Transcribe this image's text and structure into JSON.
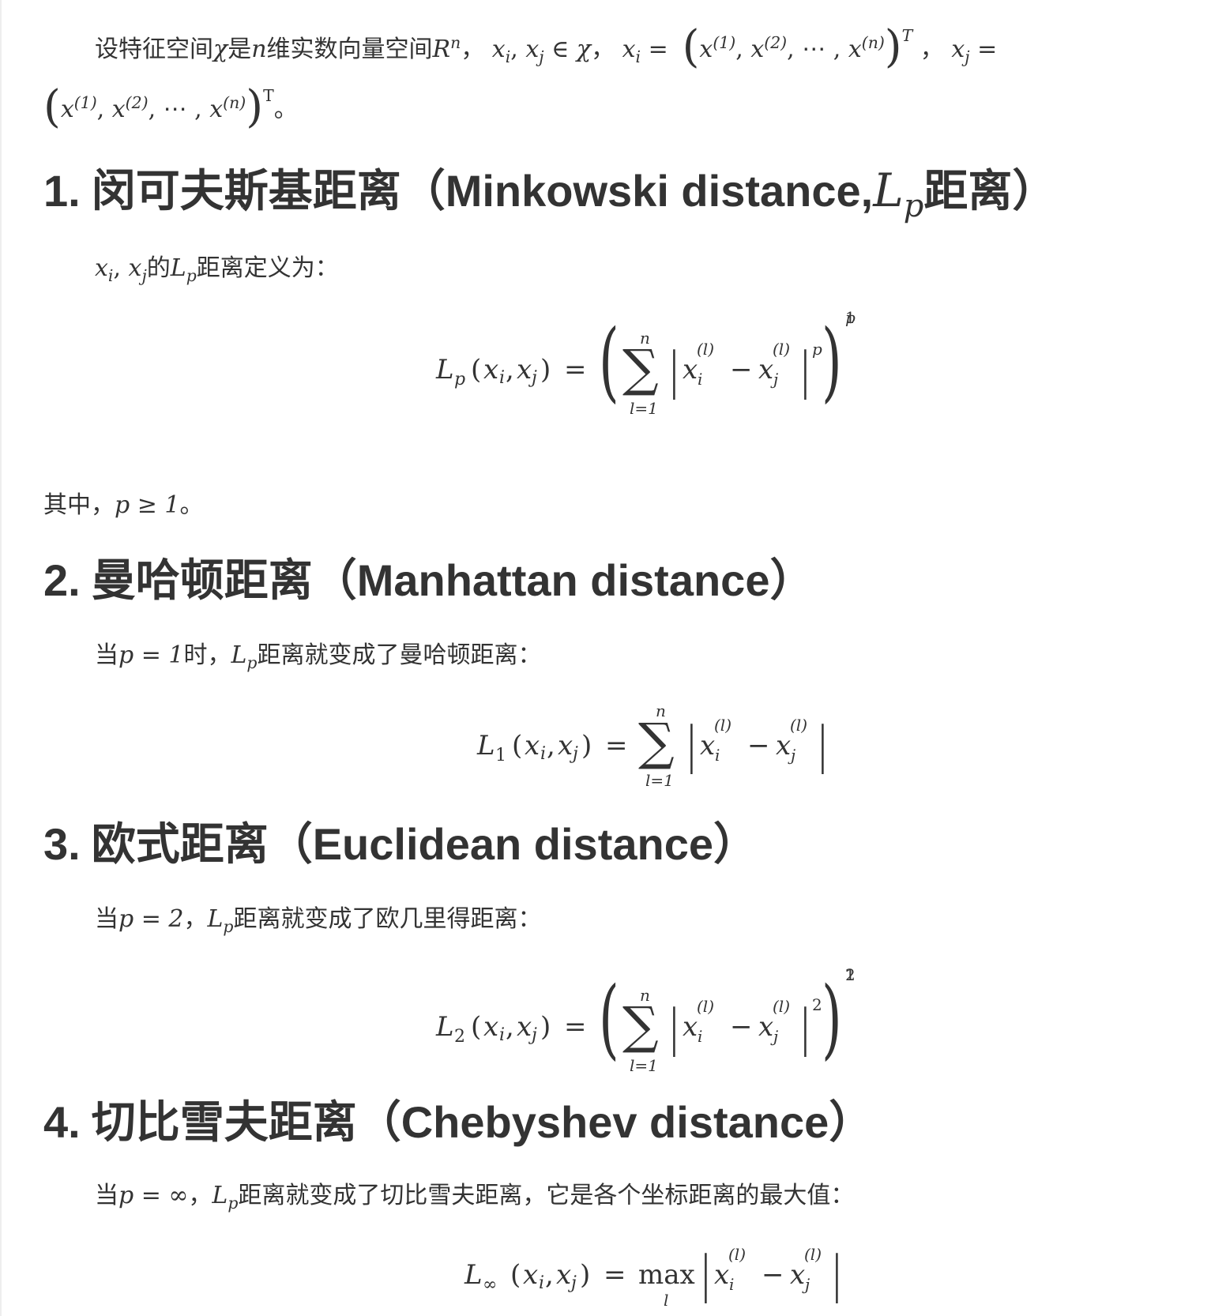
{
  "intro": {
    "t1": "设特征空间",
    "chi": "χ",
    "t2": "是",
    "n": "n",
    "t3": "维实数向量空间",
    "R": "R",
    "Rsup": "n",
    "t4": "，",
    "xixj_in": "x",
    "t5": "，",
    "xi_def": "x",
    "comp1": "(1)",
    "comp2": "(2)",
    "compn": "(n)",
    "dots": "⋯",
    "T_italic": "T",
    "T_roman": "T",
    "period": "。"
  },
  "sections": [
    {
      "number": "1.",
      "title_cn": "闵可夫斯基距离（Minkowski distance,",
      "title_math": "L",
      "title_math_sub": "p",
      "title_tail": "距离）",
      "intro_before": "的",
      "intro_after": "距离定义为：",
      "note_before": "其中，",
      "note_math": "p ≥ 1",
      "note_after": "。"
    },
    {
      "number": "2.",
      "title_cn": "曼哈顿距离（Manhattan distance）",
      "intro_lead": "当",
      "intro_math": "p = 1",
      "intro_mid": "时，",
      "intro_after": "距离就变成了曼哈顿距离："
    },
    {
      "number": "3.",
      "title_cn": "欧式距离（Euclidean distance）",
      "intro_lead": "当",
      "intro_math": "p = 2",
      "intro_mid": "，",
      "intro_after": "距离就变成了欧几里得距离："
    },
    {
      "number": "4.",
      "title_cn": "切比雪夫距离（Chebyshev distance）",
      "intro_lead": "当",
      "intro_math": "p = ∞",
      "intro_mid": "，",
      "intro_after": "距离就变成了切比雪夫距离，它是各个坐标距离的最大值："
    }
  ],
  "math": {
    "x": "x",
    "i": "i",
    "j": "j",
    "l": "l",
    "lsup": "(l)",
    "L": "L",
    "p": "p",
    "n": "n",
    "one": "1",
    "two": "2",
    "inf": "∞",
    "eq": "=",
    "minus": "−",
    "sum": "∑",
    "lower": "l=1",
    "max": "max",
    "args": "(x",
    "comma": ",",
    "in": "∈",
    "chi": "χ"
  }
}
